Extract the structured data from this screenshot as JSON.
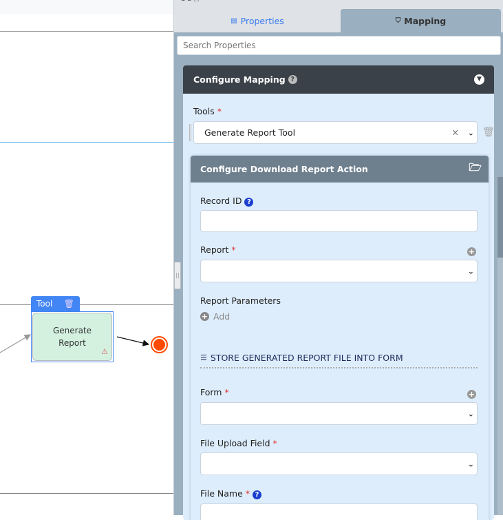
{
  "canvas": {
    "node": {
      "type_label": "Tool",
      "title_line1": "Generate",
      "title_line2": "Report"
    }
  },
  "panel": {
    "tabs": [
      {
        "label": "Properties",
        "icon": "file-icon",
        "active": false
      },
      {
        "label": "Mapping",
        "icon": "handshake-icon",
        "active": true
      }
    ],
    "search": {
      "placeholder": "Search Properties",
      "value": ""
    },
    "mapping_card": {
      "title": "Configure Mapping",
      "tools_label": "Tools",
      "tools_value": "Generate Report Tool"
    },
    "action_card": {
      "title": "Configure Download Report Action",
      "record_id_label": "Record ID",
      "report_label": "Report",
      "report_params_label": "Report Parameters",
      "add_label": "Add",
      "section_title": "STORE GENERATED REPORT FILE INTO FORM",
      "form_label": "Form",
      "file_upload_label": "File Upload Field",
      "file_name_label": "File Name"
    },
    "required_mark": "*"
  },
  "colors": {
    "accent": "#4285f4",
    "active_tab": "#9aafc0",
    "card_header": "#3a4149",
    "sub_header": "#6e7f8e",
    "node_fill": "#d4f1e0",
    "end_event": "#ff4a00"
  }
}
